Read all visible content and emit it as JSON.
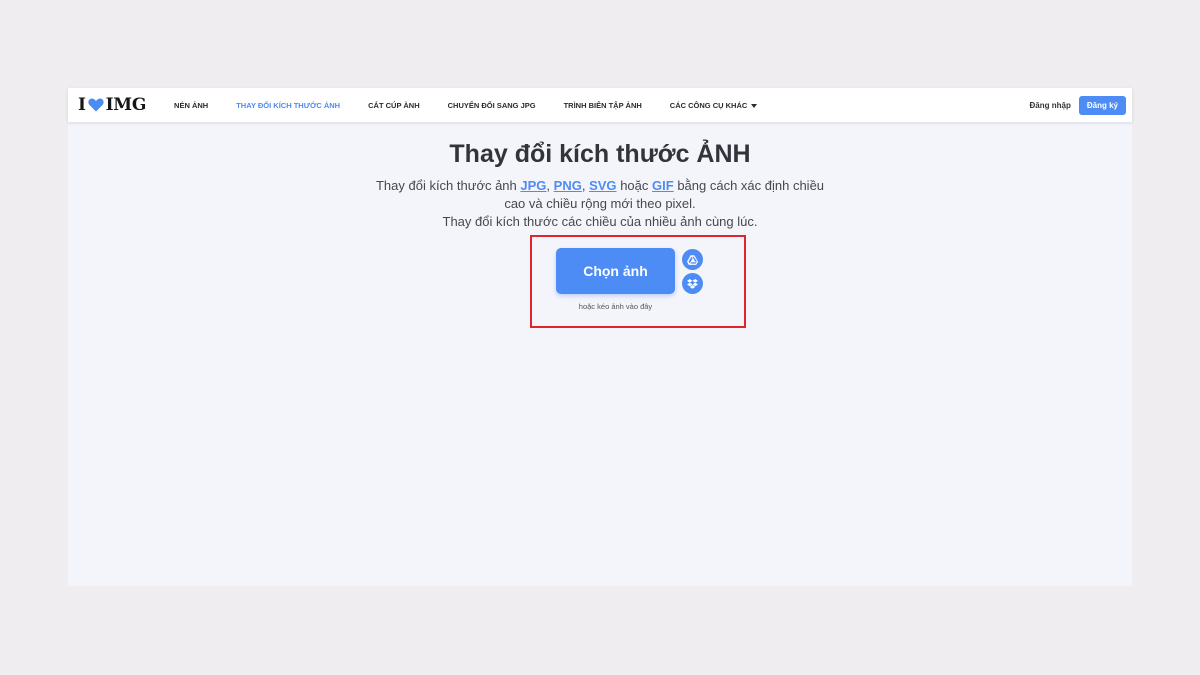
{
  "brand": {
    "logo_left": "I",
    "logo_right": "IMG",
    "accent": "#4d8cf5"
  },
  "nav": {
    "items": [
      {
        "label": "NÉN ẢNH"
      },
      {
        "label": "THAY ĐỔI KÍCH THƯỚC ẢNH",
        "active": true
      },
      {
        "label": "CẮT CÚP ẢNH"
      },
      {
        "label": "CHUYỂN ĐỔI SANG JPG"
      },
      {
        "label": "TRÌNH BIÊN TẬP ẢNH"
      },
      {
        "label": "CÁC CÔNG CỤ KHÁC"
      }
    ],
    "login": "Đăng nhập",
    "signup": "Đăng ký"
  },
  "main": {
    "title": "Thay đổi kích thước ẢNH",
    "desc": {
      "prefix": "Thay đổi kích thước ảnh",
      "formats": [
        "JPG",
        "PNG",
        "SVG",
        "GIF"
      ],
      "sep": ",",
      "or": "hoặc",
      "line1_rest": "bằng cách xác định chiều",
      "line2": "cao và chiều rộng mới theo pixel.",
      "line3": "Thay đổi kích thước các chiều của nhiều ảnh cùng lúc."
    },
    "choose_button": "Chọn ảnh",
    "drop_hint": "hoặc kéo ảnh vào đây",
    "highlight_color": "#e0262d"
  },
  "icons": {
    "logo_heart": "heart-icon",
    "dropdown": "caret-down-icon",
    "drive": "google-drive-icon",
    "dropbox": "dropbox-icon"
  }
}
